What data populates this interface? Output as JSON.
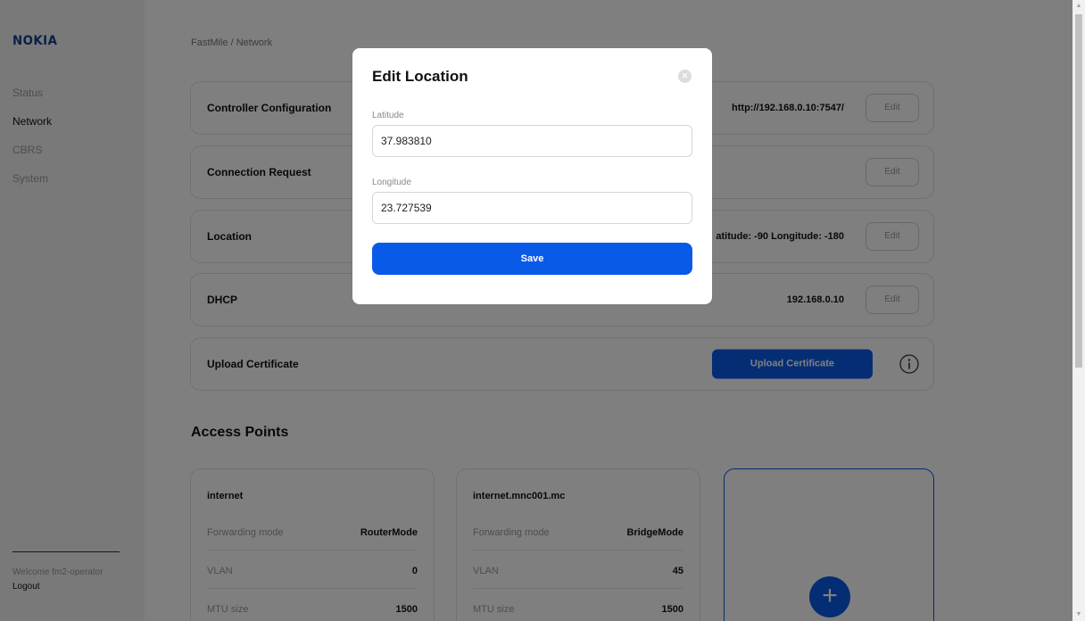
{
  "sidebar": {
    "logo": "NOKIA",
    "items": [
      {
        "label": "Status",
        "active": false
      },
      {
        "label": "Network",
        "active": true
      },
      {
        "label": "CBRS",
        "active": false
      },
      {
        "label": "System",
        "active": false
      }
    ],
    "welcome": "Welcome fm2-operator",
    "logout": "Logout"
  },
  "main": {
    "breadcrumb": "FastMile / Network",
    "cards": [
      {
        "title": "Controller Configuration",
        "value": "http://192.168.0.10:7547/",
        "button": "Edit"
      },
      {
        "title": "Connection Request",
        "value": "",
        "button": "Edit"
      },
      {
        "title": "Location",
        "value": "atitude: -90 Longitude: -180",
        "button": "Edit"
      },
      {
        "title": "DHCP",
        "value": "192.168.0.10",
        "button": "Edit"
      }
    ],
    "upload": {
      "title": "Upload Certificate",
      "button": "Upload Certificate",
      "icon": "info-icon"
    },
    "access_points_title": "Access Points",
    "access_points": [
      {
        "name": "internet",
        "rows": [
          {
            "key": "Forwarding mode",
            "value": "RouterMode"
          },
          {
            "key": "VLAN",
            "value": "0"
          },
          {
            "key": "MTU size",
            "value": "1500"
          }
        ]
      },
      {
        "name": "internet.mnc001.mc",
        "rows": [
          {
            "key": "Forwarding mode",
            "value": "BridgeMode"
          },
          {
            "key": "VLAN",
            "value": "45"
          },
          {
            "key": "MTU size",
            "value": "1500"
          }
        ]
      }
    ],
    "add_icon": "+"
  },
  "modal": {
    "title": "Edit Location",
    "close_icon": "close-icon",
    "latitude_label": "Latitude",
    "latitude_value": "37.983810",
    "longitude_label": "Longitude",
    "longitude_value": "23.727539",
    "save_label": "Save"
  },
  "colors": {
    "accent": "#0a5ae8",
    "brand": "#124191",
    "overlay": "rgba(0,0,0,0.5)"
  }
}
